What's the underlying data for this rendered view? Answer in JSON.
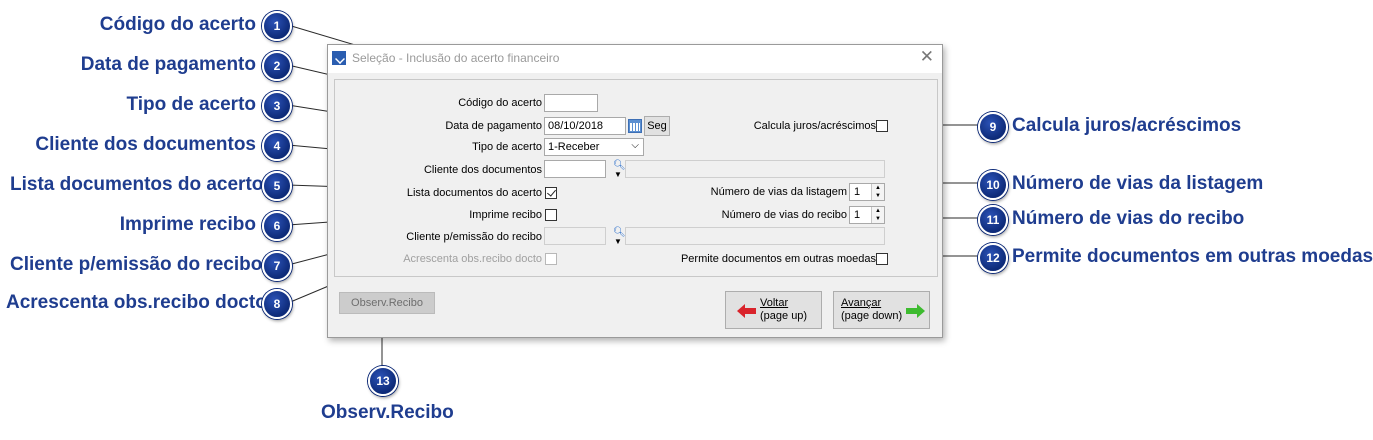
{
  "annotations": {
    "a1": {
      "num": "1",
      "label": "Código do acerto"
    },
    "a2": {
      "num": "2",
      "label": "Data de pagamento"
    },
    "a3": {
      "num": "3",
      "label": "Tipo de acerto"
    },
    "a4": {
      "num": "4",
      "label": "Cliente dos documentos"
    },
    "a5": {
      "num": "5",
      "label": "Lista documentos do acerto"
    },
    "a6": {
      "num": "6",
      "label": "Imprime recibo"
    },
    "a7": {
      "num": "7",
      "label": "Cliente p/emissão do recibo"
    },
    "a8": {
      "num": "8",
      "label": "Acrescenta obs.recibo docto"
    },
    "a9": {
      "num": "9",
      "label": "Calcula juros/acréscimos"
    },
    "a10": {
      "num": "10",
      "label": "Número de vias da listagem"
    },
    "a11": {
      "num": "11",
      "label": "Número de vias do recibo"
    },
    "a12": {
      "num": "12",
      "label": "Permite documentos em outras moedas"
    },
    "a13": {
      "num": "13",
      "label": "Observ.Recibo"
    }
  },
  "window": {
    "title": "Seleção - Inclusão do acerto financeiro",
    "close": "✕"
  },
  "form": {
    "codigo_label": "Código do acerto",
    "codigo_value": "",
    "data_label": "Data de pagamento",
    "data_value": "08/10/2018",
    "dia_semana": "Seg",
    "tipo_label": "Tipo de acerto",
    "tipo_value": "1-Receber",
    "cliente_docs_label": "Cliente dos documentos",
    "lista_docs_label": "Lista documentos do acerto",
    "lista_docs_checked": true,
    "imprime_label": "Imprime recibo",
    "imprime_checked": false,
    "cliente_recibo_label": "Cliente p/emissão do recibo",
    "acrescenta_label": "Acrescenta obs.recibo docto",
    "calcula_label": "Calcula juros/acréscimos",
    "vias_listagem_label": "Número de vias da listagem",
    "vias_listagem_value": "1",
    "vias_recibo_label": "Número de vias do recibo",
    "vias_recibo_value": "1",
    "moedas_label": "Permite documentos em outras moedas"
  },
  "buttons": {
    "observ": "Observ.Recibo",
    "voltar_line1": "Voltar",
    "voltar_line2": "(page up)",
    "avancar_line1": "Avançar",
    "avancar_line2": "(page down)"
  },
  "colors": {
    "annotation": "#1f3d8f",
    "badge": "#0d2a78",
    "back_arrow": "#d9232b",
    "next_arrow": "#3dbb2f"
  }
}
